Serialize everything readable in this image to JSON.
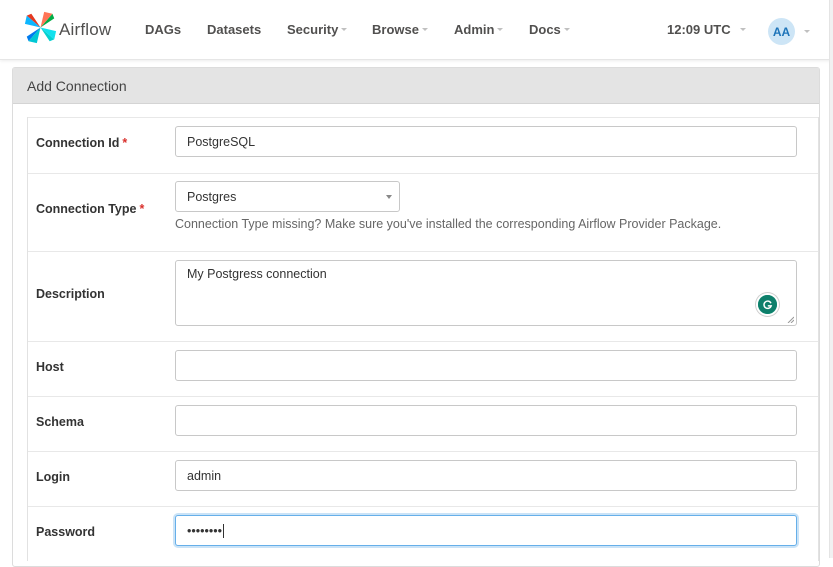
{
  "navbar": {
    "brand": "Airflow",
    "items": [
      {
        "label": "DAGs"
      },
      {
        "label": "Datasets"
      },
      {
        "label": "Security"
      },
      {
        "label": "Browse"
      },
      {
        "label": "Admin"
      },
      {
        "label": "Docs"
      }
    ],
    "clock": "12:09 UTC",
    "avatar": "AA"
  },
  "panel": {
    "title": "Add Connection"
  },
  "form": {
    "conn_id": {
      "label": "Connection Id",
      "required": "*",
      "value": "PostgreSQL"
    },
    "conn_type": {
      "label": "Connection Type",
      "required": "*",
      "value": "Postgres",
      "help": "Connection Type missing? Make sure you've installed the corresponding Airflow Provider Package."
    },
    "description": {
      "label": "Description",
      "value": "My Postgress connection"
    },
    "host": {
      "label": "Host",
      "value": ""
    },
    "schema": {
      "label": "Schema",
      "value": ""
    },
    "login": {
      "label": "Login",
      "value": "admin"
    },
    "password": {
      "label": "Password",
      "value": "••••••••"
    }
  },
  "icons": {
    "brand_logo": "airflow-pinwheel-icon",
    "grammarly": "grammarly-icon"
  }
}
